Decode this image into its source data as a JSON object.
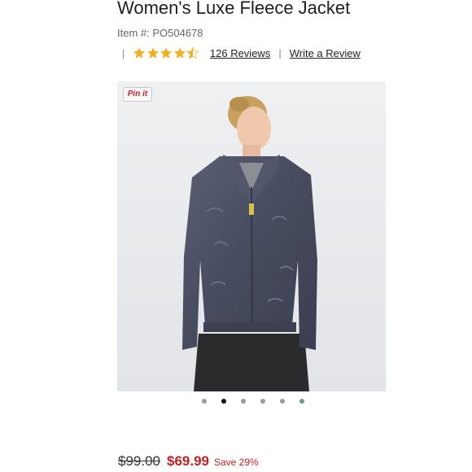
{
  "product": {
    "title": "Women's Luxe Fleece Jacket",
    "item_number": "Item #: PO504678",
    "rating": 4.5,
    "rating_max": 5,
    "reviews_label": "126 Reviews",
    "write_review_label": "Write a Review",
    "separator": "|"
  },
  "image": {
    "pin_label": "Pin it",
    "carousel_count": 6,
    "carousel_active_index": 1
  },
  "pricing": {
    "original_price": "$99.00",
    "sale_price": "$69.99",
    "savings": "Save 29%"
  },
  "colors": {
    "star": "#f2b01e",
    "sale": "#c41e23",
    "jacket": "#4a4f63"
  }
}
